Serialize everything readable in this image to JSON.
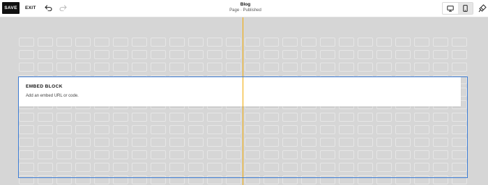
{
  "toolbar": {
    "save_label": "SAVE",
    "exit_label": "EXIT",
    "undo_icon": "undo-icon",
    "redo_icon": "redo-icon",
    "style_icon": "paint-brush-icon"
  },
  "page": {
    "title": "Blog",
    "status": "Page · Published"
  },
  "device_toggle": {
    "options": [
      "desktop-icon",
      "mobile-icon"
    ],
    "selected": "mobile"
  },
  "embed_block": {
    "title": "EMBED BLOCK",
    "description": "Add an embed URL or code."
  },
  "colors": {
    "guide": "#f2a900",
    "selection": "#3a7bd5",
    "canvas": "#d6d6d6"
  }
}
